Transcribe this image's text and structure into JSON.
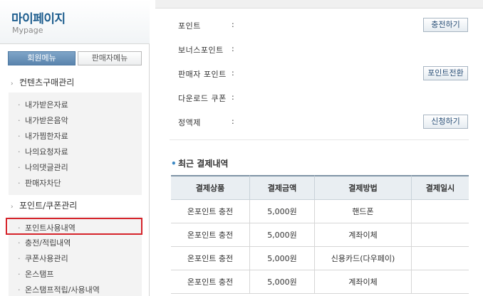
{
  "sidebar": {
    "title": "마이페이지",
    "subtitle": "Mypage",
    "tabs": {
      "member": "회원메뉴",
      "seller": "판매자메뉴"
    },
    "sections": [
      {
        "label": "컨텐츠구매관리",
        "items": [
          "내가받은자료",
          "내가받은음악",
          "내가찜한자료",
          "나의요청자료",
          "나의댓글관리",
          "판매자차단"
        ]
      },
      {
        "label": "포인트/쿠폰관리",
        "items": [
          "포인트사용내역",
          "충전/적립내역",
          "쿠폰사용관리",
          "온스탬프",
          "온스탬프적립/사용내역"
        ]
      }
    ]
  },
  "points": {
    "rows": [
      {
        "label": "포인트",
        "colon": ":",
        "button": "충전하기"
      },
      {
        "label": "보너스포인트",
        "colon": ":"
      },
      {
        "label": "판매자 포인트",
        "colon": ":",
        "button": "포인트전환"
      },
      {
        "label": "다운로드 쿠폰",
        "colon": ":"
      },
      {
        "label": "정액제",
        "colon": ":",
        "button": "신청하기"
      }
    ]
  },
  "history": {
    "title": "최근 결제내역",
    "columns": [
      "결제상품",
      "결제금액",
      "결제방법",
      "결제일시"
    ],
    "rows": [
      [
        "온포인트 충전",
        "5,000원",
        "핸드폰",
        ""
      ],
      [
        "온포인트 충전",
        "5,000원",
        "계좌이체",
        ""
      ],
      [
        "온포인트 충전",
        "5,000원",
        "신용카드(다우페이)",
        ""
      ],
      [
        "온포인트 충전",
        "5,000원",
        "계좌이체",
        ""
      ]
    ]
  },
  "colors": {
    "accent": "#1d5d8e",
    "highlight": "#d5232a",
    "tab_active": "#5a84ad"
  }
}
